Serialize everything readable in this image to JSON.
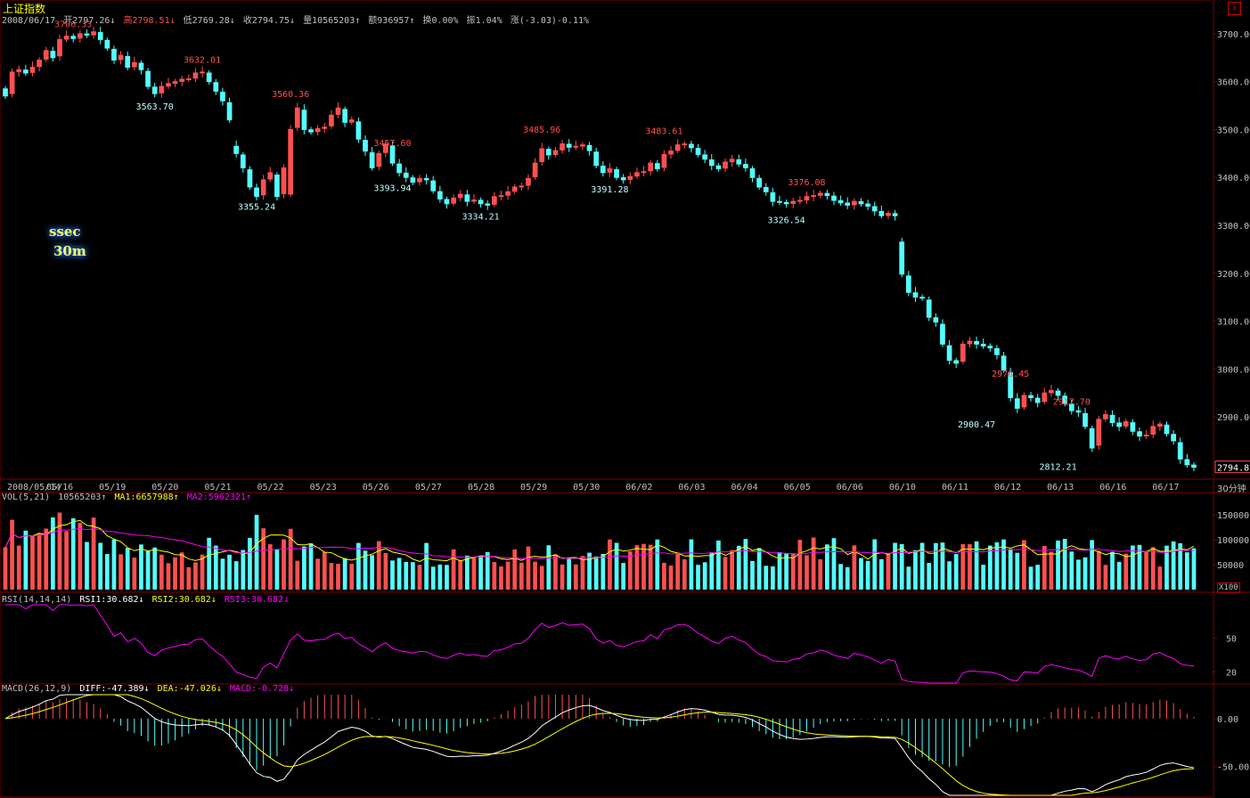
{
  "title": "上证指数",
  "header": {
    "date": "2008/06/17",
    "open": "开2797.26↓",
    "high": "高2798.51↓",
    "low": "低2769.28↓",
    "close": "收2794.75↓",
    "volume": "量10565203↑",
    "amount": "额936957↑",
    "turnover": "换0.00%",
    "amplitude": "振1.04%",
    "change": "涨(-3.03)-0.11%"
  },
  "watermark": {
    "line1": "ssec",
    "line2": "30m"
  },
  "period_label": "30分钟",
  "close_icon": "close-icon",
  "current_price_label": "2794.8",
  "colors": {
    "up": "#ff5050",
    "down": "#54ffff",
    "grid": "#800000",
    "ma1": "#ffffff",
    "ma2": "#ffff00",
    "ma3": "#ff00ff"
  },
  "chart_data": [
    {
      "type": "candlestick",
      "panel": "price",
      "yticks": [
        2900,
        3000,
        3100,
        3200,
        3300,
        3400,
        3500,
        3600,
        3700
      ],
      "ytick_labels": [
        "2900.00",
        "3000.00",
        "3100.00",
        "3200.00",
        "3300.00",
        "3400.00",
        "3500.00",
        "3600.00",
        "3700.00"
      ],
      "ylim": [
        2770,
        3750
      ],
      "date_labels": [
        "2008/05/14",
        "05/16",
        "05/19",
        "05/20",
        "05/21",
        "05/22",
        "05/23",
        "05/26",
        "05/27",
        "05/28",
        "05/29",
        "05/30",
        "06/02",
        "06/03",
        "06/04",
        "06/05",
        "06/06",
        "06/10",
        "06/11",
        "06/12",
        "06/13",
        "06/16",
        "06/17"
      ],
      "annotations": [
        {
          "text": "3706.33",
          "i": 10,
          "v": 3706.33,
          "kind": "high"
        },
        {
          "text": "3563.70",
          "i": 22,
          "v": 3563.7,
          "kind": "low"
        },
        {
          "text": "3632.01",
          "i": 29,
          "v": 3632.01,
          "kind": "high"
        },
        {
          "text": "3355.24",
          "i": 37,
          "v": 3355.24,
          "kind": "low"
        },
        {
          "text": "3560.36",
          "i": 42,
          "v": 3560.36,
          "kind": "high"
        },
        {
          "text": "3457.60",
          "i": 57,
          "v": 3457.6,
          "kind": "high"
        },
        {
          "text": "3393.94",
          "i": 57,
          "v": 3393.94,
          "kind": "low"
        },
        {
          "text": "3334.21",
          "i": 70,
          "v": 3334.21,
          "kind": "low"
        },
        {
          "text": "3485.96",
          "i": 79,
          "v": 3485.96,
          "kind": "high"
        },
        {
          "text": "3391.28",
          "i": 89,
          "v": 3391.28,
          "kind": "low"
        },
        {
          "text": "3483.61",
          "i": 97,
          "v": 3483.61,
          "kind": "high"
        },
        {
          "text": "3376.08",
          "i": 118,
          "v": 3376.08,
          "kind": "high"
        },
        {
          "text": "3326.54",
          "i": 115,
          "v": 3326.54,
          "kind": "low"
        },
        {
          "text": "2976.45",
          "i": 148,
          "v": 2976.45,
          "kind": "high"
        },
        {
          "text": "2900.47",
          "i": 143,
          "v": 2900.47,
          "kind": "low"
        },
        {
          "text": "2917.70",
          "i": 157,
          "v": 2917.7,
          "kind": "high"
        },
        {
          "text": "2812.21",
          "i": 155,
          "v": 2812.21,
          "kind": "low"
        }
      ],
      "closes": [
        3570,
        3620,
        3625,
        3618,
        3630,
        3645,
        3665,
        3650,
        3688,
        3695,
        3690,
        3700,
        3697,
        3704,
        3688,
        3670,
        3645,
        3655,
        3630,
        3640,
        3625,
        3590,
        3575,
        3590,
        3596,
        3600,
        3605,
        3606,
        3618,
        3620,
        3600,
        3580,
        3560,
        3520,
        3450,
        3420,
        3380,
        3360,
        3395,
        3410,
        3360,
        3420,
        3500,
        3545,
        3500,
        3495,
        3502,
        3505,
        3530,
        3545,
        3515,
        3520,
        3480,
        3455,
        3420,
        3450,
        3470,
        3430,
        3410,
        3400,
        3390,
        3398,
        3395,
        3372,
        3355,
        3345,
        3357,
        3365,
        3350,
        3353,
        3345,
        3342,
        3360,
        3362,
        3370,
        3380,
        3382,
        3398,
        3430,
        3460,
        3447,
        3456,
        3470,
        3463,
        3465,
        3468,
        3456,
        3425,
        3410,
        3418,
        3400,
        3395,
        3402,
        3410,
        3412,
        3430,
        3418,
        3448,
        3455,
        3468,
        3470,
        3462,
        3448,
        3438,
        3425,
        3418,
        3432,
        3438,
        3428,
        3420,
        3400,
        3380,
        3370,
        3350,
        3348,
        3345,
        3350,
        3352,
        3360,
        3362,
        3367,
        3362,
        3352,
        3347,
        3342,
        3350,
        3345,
        3340,
        3330,
        3320,
        3325,
        3320,
        3198,
        3160,
        3150,
        3148,
        3108,
        3098,
        3052,
        3018,
        3012,
        3052,
        3058,
        3052,
        3048,
        3044,
        3030,
        2998,
        2940,
        2918,
        2945,
        2940,
        2930,
        2950,
        2955,
        2945,
        2928,
        2913,
        2910,
        2880,
        2835,
        2895,
        2905,
        2888,
        2880,
        2890,
        2870,
        2860,
        2862,
        2880,
        2885,
        2865,
        2850,
        2812,
        2800,
        2794.75
      ],
      "volume_ticks": [
        50000,
        100000,
        150000
      ],
      "volume_unit": "X100",
      "volume_legend": {
        "vol": "VOL(5,21)",
        "value": "10565203↑",
        "ma1": "MA1:6657988↑",
        "ma2": "MA2:5962321↑"
      }
    },
    {
      "type": "line",
      "panel": "rsi",
      "legend": {
        "name": "RSI(14,14,14)",
        "rsi1": "RSI1:30.682↓",
        "rsi2": "RSI2:30.682↓",
        "rsi3": "RSI3:30.682↓"
      },
      "yticks": [
        20,
        50
      ],
      "ylim": [
        10,
        80
      ]
    },
    {
      "type": "line",
      "panel": "macd",
      "legend": {
        "name": "MACD(26,12,9)",
        "diff": "DIFF:-47.389↓",
        "dea": "DEA:-47.026↓",
        "macd": "MACD:-0.728↓"
      },
      "yticks": [
        -50,
        0
      ],
      "ytick_labels": [
        "-50.00",
        "0.00"
      ],
      "ylim": [
        -80,
        25
      ]
    }
  ]
}
